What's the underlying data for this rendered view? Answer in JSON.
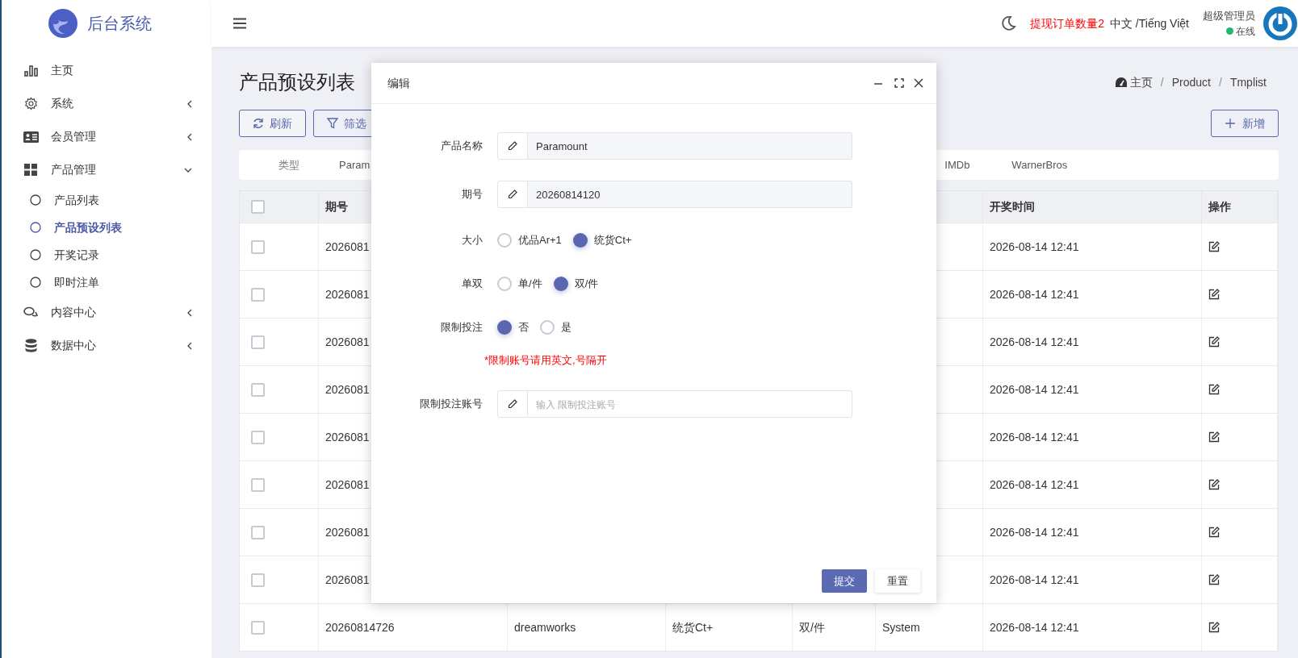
{
  "sidebar": {
    "brand": "后台系统",
    "items": [
      {
        "label": "主页",
        "selected": false
      },
      {
        "label": "系统",
        "selected": false,
        "expanded": false
      },
      {
        "label": "会员管理",
        "selected": false,
        "expanded": false
      },
      {
        "label": "产品管理",
        "selected": false,
        "expanded": true,
        "children": [
          {
            "label": "产品列表",
            "selected": false
          },
          {
            "label": "产品预设列表",
            "selected": true
          },
          {
            "label": "开奖记录",
            "selected": false
          },
          {
            "label": "即时注单",
            "selected": false
          }
        ]
      },
      {
        "label": "内容中心",
        "selected": false,
        "expanded": false
      },
      {
        "label": "数据中心",
        "selected": false,
        "expanded": false
      }
    ]
  },
  "header": {
    "notice": "提现订单数量2",
    "language": "中文 /Tiếng Việt",
    "user": {
      "name": "超级管理员",
      "status": "在线"
    }
  },
  "page": {
    "title": "产品预设列表",
    "breadcrumb": [
      "主页",
      "Product",
      "Tmplist"
    ],
    "breadcrumb_separator": "/",
    "buttons": {
      "refresh": "刷新",
      "filter": "筛选",
      "add": "新增"
    }
  },
  "filter_bar": {
    "items_left": [
      "类型",
      "Param"
    ],
    "items_right": [
      "IMDb",
      "WarnerBros"
    ]
  },
  "table": {
    "header_checked": false,
    "columns": {
      "issue": "期号",
      "time": "开奖时间",
      "actions": "操作"
    },
    "rows": [
      {
        "checked": false,
        "issue": "2026081",
        "time": "2026-08-14 12:41"
      },
      {
        "checked": false,
        "issue": "2026081",
        "time": "2026-08-14 12:41"
      },
      {
        "checked": false,
        "issue": "2026081",
        "time": "2026-08-14 12:41"
      },
      {
        "checked": false,
        "issue": "2026081",
        "time": "2026-08-14 12:41"
      },
      {
        "checked": false,
        "issue": "2026081",
        "time": "2026-08-14 12:41"
      },
      {
        "checked": false,
        "issue": "2026081",
        "time": "2026-08-14 12:41"
      },
      {
        "checked": false,
        "issue": "2026081",
        "time": "2026-08-14 12:41"
      },
      {
        "checked": false,
        "issue": "2026081",
        "time": "2026-08-14 12:41"
      },
      {
        "checked": false,
        "issue": "20260814726",
        "column_3": "dreamworks",
        "column_4": "统货Ct+",
        "column_5": "双/件",
        "column_6": "System",
        "time": "2026-08-14 12:41"
      }
    ]
  },
  "dialog": {
    "title": "编辑",
    "fields": [
      {
        "kind": "text",
        "label": "产品名称",
        "value": "Paramount"
      },
      {
        "kind": "text",
        "label": "期号",
        "value": "20260814120"
      },
      {
        "kind": "radio",
        "label": "大小",
        "options": [
          {
            "label": "优品Ar+1",
            "selected": false
          },
          {
            "label": "统货Ct+",
            "selected": true
          }
        ]
      },
      {
        "kind": "radio",
        "label": "单双",
        "options": [
          {
            "label": "单/件",
            "selected": false
          },
          {
            "label": "双/件",
            "selected": true
          }
        ]
      },
      {
        "kind": "radio",
        "label": "限制投注",
        "options": [
          {
            "label": "否",
            "selected": true
          },
          {
            "label": "是",
            "selected": false
          }
        ]
      },
      {
        "kind": "note",
        "text": "*限制账号请用英文,号隔开"
      },
      {
        "kind": "text",
        "label": "限制投注账号",
        "placeholder": "输入 限制投注账号"
      }
    ],
    "buttons": {
      "submit": "提交",
      "reset": "重置"
    }
  }
}
